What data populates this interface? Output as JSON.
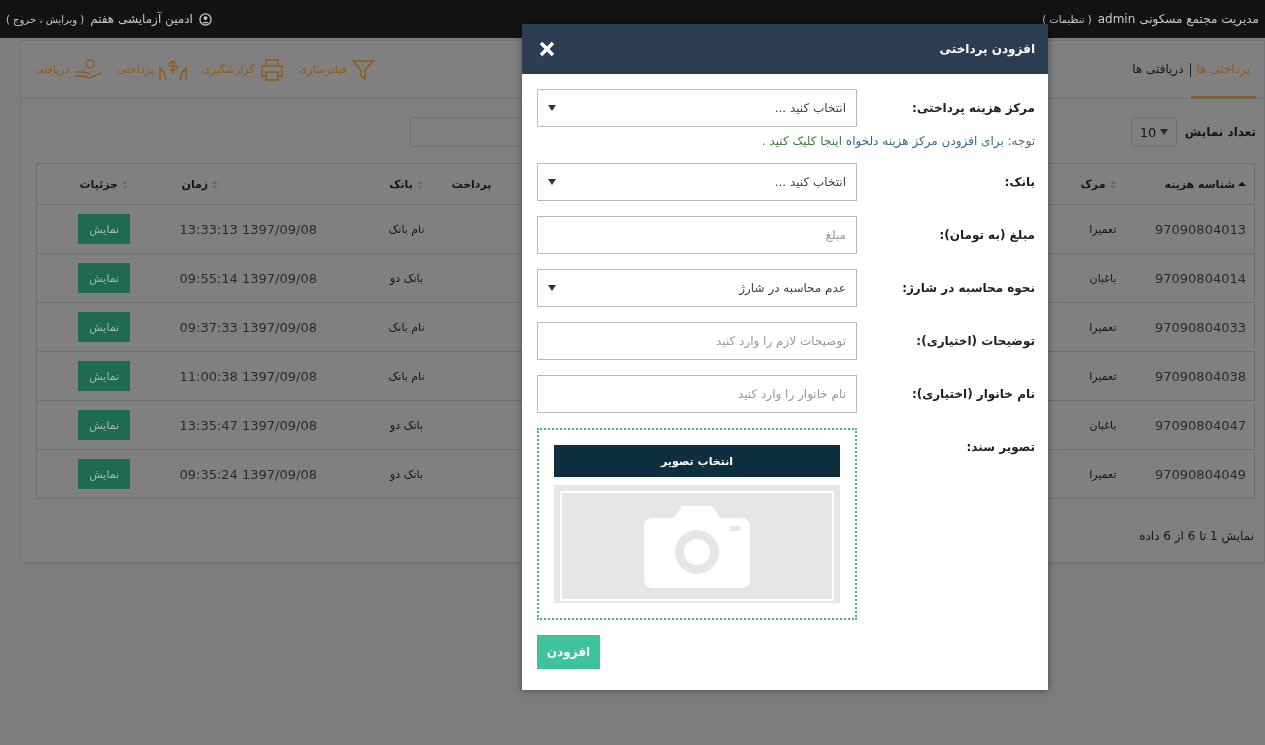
{
  "top_bar": {
    "title": "مدیریت مجتمع مسکونی admin",
    "settings_link": "( تنظیمات )",
    "user_name": "ادمین آزمایشی هفتم",
    "user_links": "( ویرایش ، خروج )"
  },
  "tabs": [
    {
      "label": "پرداختی ها",
      "selected": true
    },
    {
      "label": "دریافتی ها",
      "selected": false
    }
  ],
  "toolbar": [
    {
      "kind": "filter",
      "label": "فیلترسازی"
    },
    {
      "kind": "print",
      "label": "گزارشگیری"
    },
    {
      "kind": "payment",
      "label": "پرداختی"
    },
    {
      "kind": "receipt",
      "label": "دریافتی"
    }
  ],
  "page_length": {
    "label": "تعداد نمایش",
    "value": "10"
  },
  "table": {
    "columns": [
      {
        "label": "شناسه هزینه",
        "sorted": true
      },
      {
        "label": "مرک",
        "sorted": false
      },
      {
        "label": "پرداخت"
      },
      {
        "label": "بانک",
        "sorted": false
      },
      {
        "label": "زمان",
        "sorted": false
      },
      {
        "label": "جزئیات",
        "sorted": false
      }
    ],
    "rows": [
      {
        "id": "97090804013",
        "column_2": "تعمیرا",
        "bank": "نام بانک",
        "time": "13:33:13 1397/09/08",
        "details": "نمایش"
      },
      {
        "id": "97090804014",
        "column_2": "باغبان",
        "bank": "بانک دو",
        "time": "09:55:14 1397/09/08",
        "details": "نمایش"
      },
      {
        "id": "97090804033",
        "column_2": "تعمیرا",
        "bank": "نام بانک",
        "time": "09:37:33 1397/09/08",
        "details": "نمایش"
      },
      {
        "id": "97090804038",
        "column_2": "تعمیرا",
        "bank": "نام بانک",
        "time": "11:00:38 1397/09/08",
        "details": "نمایش"
      },
      {
        "id": "97090804047",
        "column_2": "باغبان",
        "bank": "بانک دو",
        "time": "13:35:47 1397/09/08",
        "details": "نمایش"
      },
      {
        "id": "97090804049",
        "column_2": "تعمیرا",
        "bank": "بانک دو",
        "time": "09:35:24 1397/09/08",
        "details": "نمایش"
      }
    ]
  },
  "table_info": "نمایش 1 تا 6 از 6 داده",
  "modal": {
    "title": "افزودن پرداختی",
    "fields": [
      {
        "kind": "select",
        "label": "مرکز هزینه پرداختی:",
        "value": "انتخاب کنید ..."
      },
      {
        "kind": "note",
        "prefix": "توجه:",
        "text": "برای افزودن مرکز هزینه دلخواه",
        "link": "اینجا کلیک کنید",
        "suffix": "."
      },
      {
        "kind": "select",
        "label": "بانک:",
        "value": "انتخاب کنید ..."
      },
      {
        "kind": "input",
        "label": "مبلغ (به تومان):",
        "placeholder": "مبلغ"
      },
      {
        "kind": "select",
        "label": "نحوه محاسبه در شارژ:",
        "value": "عدم محاسبه در شارژ"
      },
      {
        "kind": "input",
        "label": "توضیحات (اختیاری):",
        "placeholder": "توضیحات لازم را وارد کنید"
      },
      {
        "kind": "input",
        "label": "نام خانوار (اختیاری):",
        "placeholder": "نام خانوار را وارد کنید"
      },
      {
        "kind": "upload",
        "label": "تصویر سند:",
        "button": "انتخاب تصویر"
      }
    ],
    "submit": "افزودن"
  }
}
